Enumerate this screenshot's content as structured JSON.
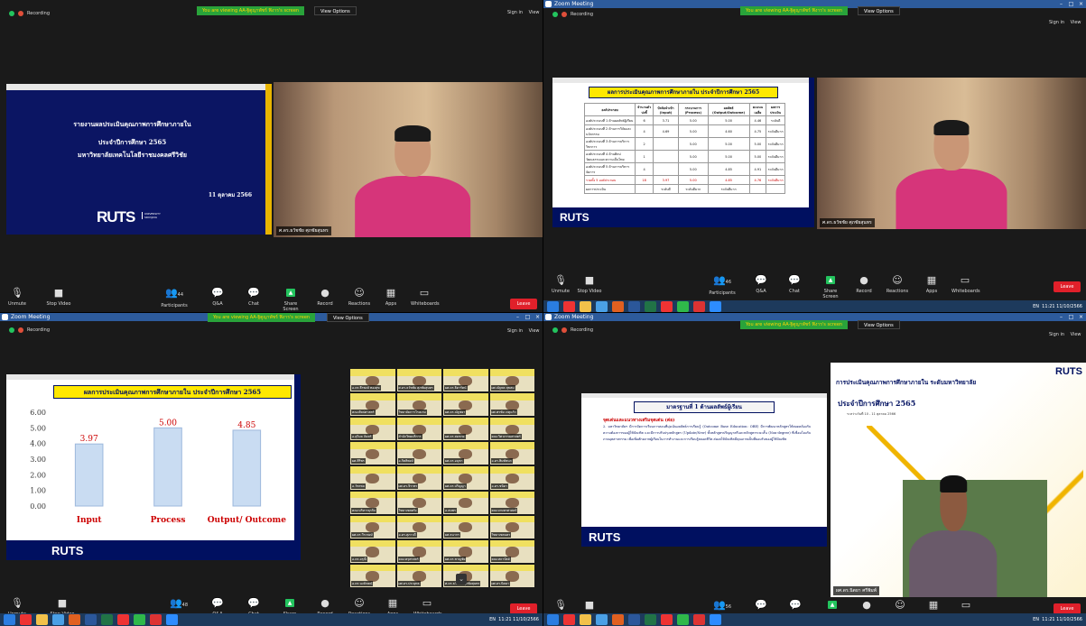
{
  "banner": {
    "text": "You are viewing AA-ฐิตูญาพัชร์ ฟิงาร's screen",
    "view_options": "View Options",
    "sign_in": "Sign in",
    "view": "View"
  },
  "recording": "Recording",
  "zoom_title": "Zoom Meeting",
  "controls": [
    {
      "id": "unmute",
      "label": "Unmute",
      "icon": "🎙"
    },
    {
      "id": "stop-video",
      "label": "Stop Video",
      "icon": "■"
    },
    {
      "id": "participants",
      "label": "Participants",
      "icon": "👥"
    },
    {
      "id": "qa",
      "label": "Q&A",
      "icon": "💬"
    },
    {
      "id": "chat",
      "label": "Chat",
      "icon": "💬"
    },
    {
      "id": "share-screen",
      "label": "Share Screen",
      "icon": "▲"
    },
    {
      "id": "record",
      "label": "Record",
      "icon": "●"
    },
    {
      "id": "reactions",
      "label": "Reactions",
      "icon": "☺"
    },
    {
      "id": "apps",
      "label": "Apps",
      "icon": "▦"
    },
    {
      "id": "whiteboards",
      "label": "Whiteboards",
      "icon": "▭"
    }
  ],
  "participant_counts": [
    "44",
    "46",
    "48",
    "56"
  ],
  "leave": "Leave",
  "speaker_name": "ศ.ดร.ธวัชชัย ศุภชัยสุนทร",
  "speaker_name2": "ผศ.ดร.นิตยา ศรีพิมพ์",
  "slide1": {
    "line1": "รายงานผลประเมินคุณภาพการศึกษาภายใน",
    "line2": "ประจำปีการศึกษา 2565",
    "line3": "มหาวิทยาลัยเทคโนโลยีราชมงคลศรีวิชัย",
    "date": "11 ตุลาคม 2566",
    "logo": "RUTS",
    "uni": "UNIVERSITY SRIVIJAYA"
  },
  "slide2": {
    "title": "ผลการประเมินคุณภาพการศึกษาภายใน ประจำปีการศึกษา 2565",
    "headers": [
      "องค์ประกอบ",
      "จำนวนตัวบ่งชี้",
      "ปัจจัยนำเข้า (Input)",
      "กระบวนการ (Process)",
      "ผลลัพธ์ (Output/Outcome)",
      "คะแนนเฉลี่ย",
      "ผลการประเมิน"
    ],
    "rows": [
      [
        "องค์ประกอบที่ 1 ด้านผลลัพธ์ผู้เรียน",
        "6",
        "3.71",
        "5.00",
        "5.00",
        "4.46",
        "ระดับดี"
      ],
      [
        "องค์ประกอบที่ 2 ด้านการวิจัยและนวัตกรรม",
        "4",
        "4.69",
        "5.00",
        "4.60",
        "4.75",
        "ระดับดีมาก"
      ],
      [
        "องค์ประกอบที่ 3 ด้านการบริการวิชาการ",
        "2",
        "",
        "5.00",
        "5.00",
        "5.00",
        "ระดับดีมาก"
      ],
      [
        "องค์ประกอบที่ 4 ด้านศิลปวัฒนธรรมและความเป็นไทย",
        "1",
        "",
        "5.00",
        "5.00",
        "5.00",
        "ระดับดีมาก"
      ],
      [
        "องค์ประกอบที่ 5 ด้านการบริหารจัดการ",
        "4",
        "",
        "5.00",
        "4.85",
        "4.91",
        "ระดับดีมาก"
      ],
      [
        "รวมทั้ง 5 องค์ประกอบ",
        "18",
        "3.97",
        "5.00",
        "4.85",
        "4.76",
        "ระดับดีมาก"
      ],
      [
        "ผลการประเมิน",
        "",
        "ระดับดี",
        "ระดับดีมาก",
        "ระดับดีมาก",
        "",
        ""
      ]
    ]
  },
  "slide3": {
    "title": "ผลการประเมินคุณภาพการศึกษาภายใน ประจำปีการศึกษา 2565"
  },
  "chart_data": {
    "type": "bar",
    "categories": [
      "Input",
      "Process",
      "Output/ Outcome"
    ],
    "values": [
      3.97,
      5.0,
      4.85
    ],
    "ylim": [
      0,
      6
    ],
    "yticks": [
      "0.00",
      "1.00",
      "2.00",
      "3.00",
      "4.00",
      "5.00",
      "6.00"
    ],
    "title": "ผลการประเมินคุณภาพการศึกษาภายใน ประจำปีการศึกษา 2565",
    "xlabel": "",
    "ylabel": "",
    "grid": false,
    "legend": "none"
  },
  "slide4": {
    "title": "มาตรฐานที่ 1 ด้านผลลัพธ์ผู้เรียน",
    "subtitle": "จุดเด่นและแนวทางเสริมจุดเด่น (ต่อ)",
    "body": "2. มหาวิทยาลัยฯ มีการจัดการเรียนการสอนที่มุ่งเน้นผลลัพธ์การเรียนรู้ (Outcome Base Education: OBE) มีการพัฒนาหลักสูตรให้สอดคล้องกับความต้องการของผู้ใช้บัณฑิต และมีการปรับปรุงหลักสูตร (Update/New) ทั้งหลักสูตรปริญญาตรีและหลักสูตรระยะสั้น (Non-degree) ที่เชื่อมโยงกับภาคอุตสาหกรรม เพื่อเพิ่มศักยภาพผู้เรียนในการทำงานและการเรียนรู้ตลอดชีวิต ส่งผลให้บัณฑิตมีคุณภาพเป็นที่ยอมรับของผู้ใช้บัณฑิต"
  },
  "side_slide": {
    "title": "การประเมินคุณภาพการศึกษาภายใน ระดับมหาวิทยาลัย",
    "year": "ประจำปีการศึกษา 2565",
    "date": "ระหว่างวันที่ 10 - 11 ตุลาคม 2566",
    "logo": "RUTS"
  },
  "gallery": [
    "อ.ดร.ธีรพงษ์ ทองสุข",
    "ศ.ดร.ธวัชชัย ศุภชัยสุนทร",
    "ผศ.ดร.ธิดารัตน์",
    "ผศ.ณัฐพล สุขสม",
    "คณะศิลปศาสตร์",
    "วิทยาลัยการโรงแรม",
    "ผศ.ดร.ณัฐชยา",
    "ผศ.พรชัย เกตุแก้ว",
    "อ.สุวิมล จันทร์",
    "สำนักวิทยบริการ",
    "ผศ.ดร.สมชาย",
    "คณะวิศวกรรมศาสตร์",
    "ผศ.ศิริพร",
    "อ.กิตติพงษ์",
    "ผศ.ดร.อนุชา",
    "อ.ดร.พิมพ์ชนก",
    "อ.วัชรพล",
    "ผศ.ดร.จิราพร",
    "ผศ.ดร.ปริญญา",
    "อ.ดร.ชนิดา",
    "คณะบริหารธุรกิจ",
    "วิทยาเขตตรัง",
    "อ.สมพร",
    "คณะเกษตรศาสตร์",
    "ผศ.ดร.วีระพงษ์",
    "อ.ดร.สุภาวดี",
    "ผศ.ธนากร",
    "วิทยาเขตนคร",
    "อ.ดร.อรุณี",
    "คณะครุศาสตร์",
    "ผศ.ดร.ชาญชัย",
    "คณะสถาปัตย์",
    "อ.ดร.นงลักษณ์",
    "ผศ.ดร.ประยุทธ",
    "ศ.ดร.ธวัชชัย ศุภชัยสุนทร",
    "ผศ.ดร.นิตยา"
  ],
  "clock": {
    "time": "11:21",
    "date": "11/10/2566",
    "lang": "EN"
  }
}
